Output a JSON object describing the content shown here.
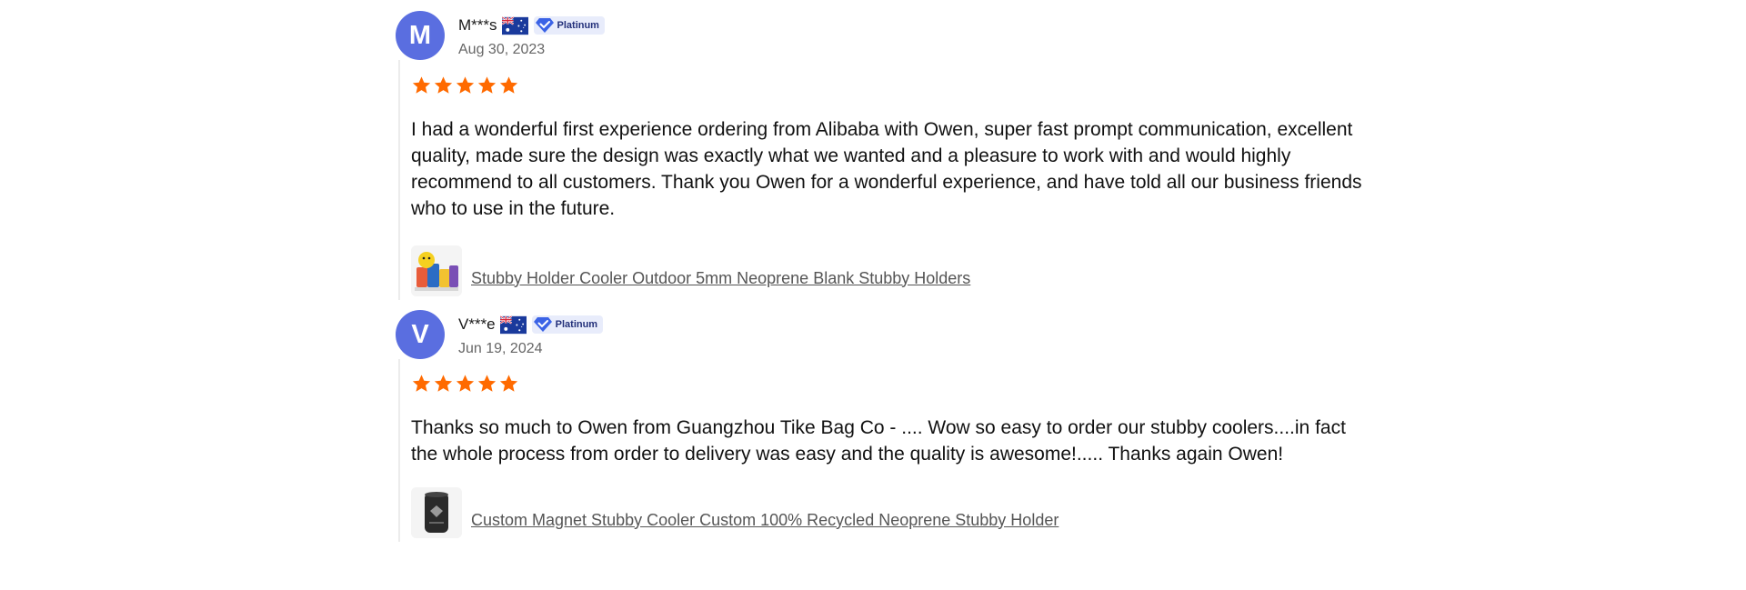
{
  "colors": {
    "avatar": "#5a6ee0",
    "star": "#ff6a00",
    "badge_bg": "#e8ecfb",
    "badge_text": "#23307a",
    "link": "#555555"
  },
  "reviews": [
    {
      "avatar_letter": "M",
      "name": "M***s",
      "flag_icon": "australia-flag-icon",
      "badge": "Platinum",
      "date": "Aug 30, 2023",
      "rating": 5,
      "text": "I had a wonderful first experience ordering from Alibaba with Owen, super fast prompt communication, excellent quality, made sure the design was exactly what we wanted and a pleasure to work with and would highly recommend to all customers. Thank you Owen for a wonderful experience, and have told all our business friends who to use in the future.",
      "product_title": "Stubby Holder Cooler Outdoor 5mm Neoprene Blank Stubby Holders"
    },
    {
      "avatar_letter": "V",
      "name": "V***e",
      "flag_icon": "australia-flag-icon",
      "badge": "Platinum",
      "date": "Jun 19, 2024",
      "rating": 5,
      "text": "Thanks so much to Owen from Guangzhou Tike Bag Co - .... Wow so easy to order our stubby coolers....in fact the whole process from order to delivery was easy and the quality is awesome!..... Thanks again Owen!",
      "product_title": "Custom Magnet Stubby Cooler Custom 100% Recycled Neoprene Stubby Holder"
    }
  ]
}
